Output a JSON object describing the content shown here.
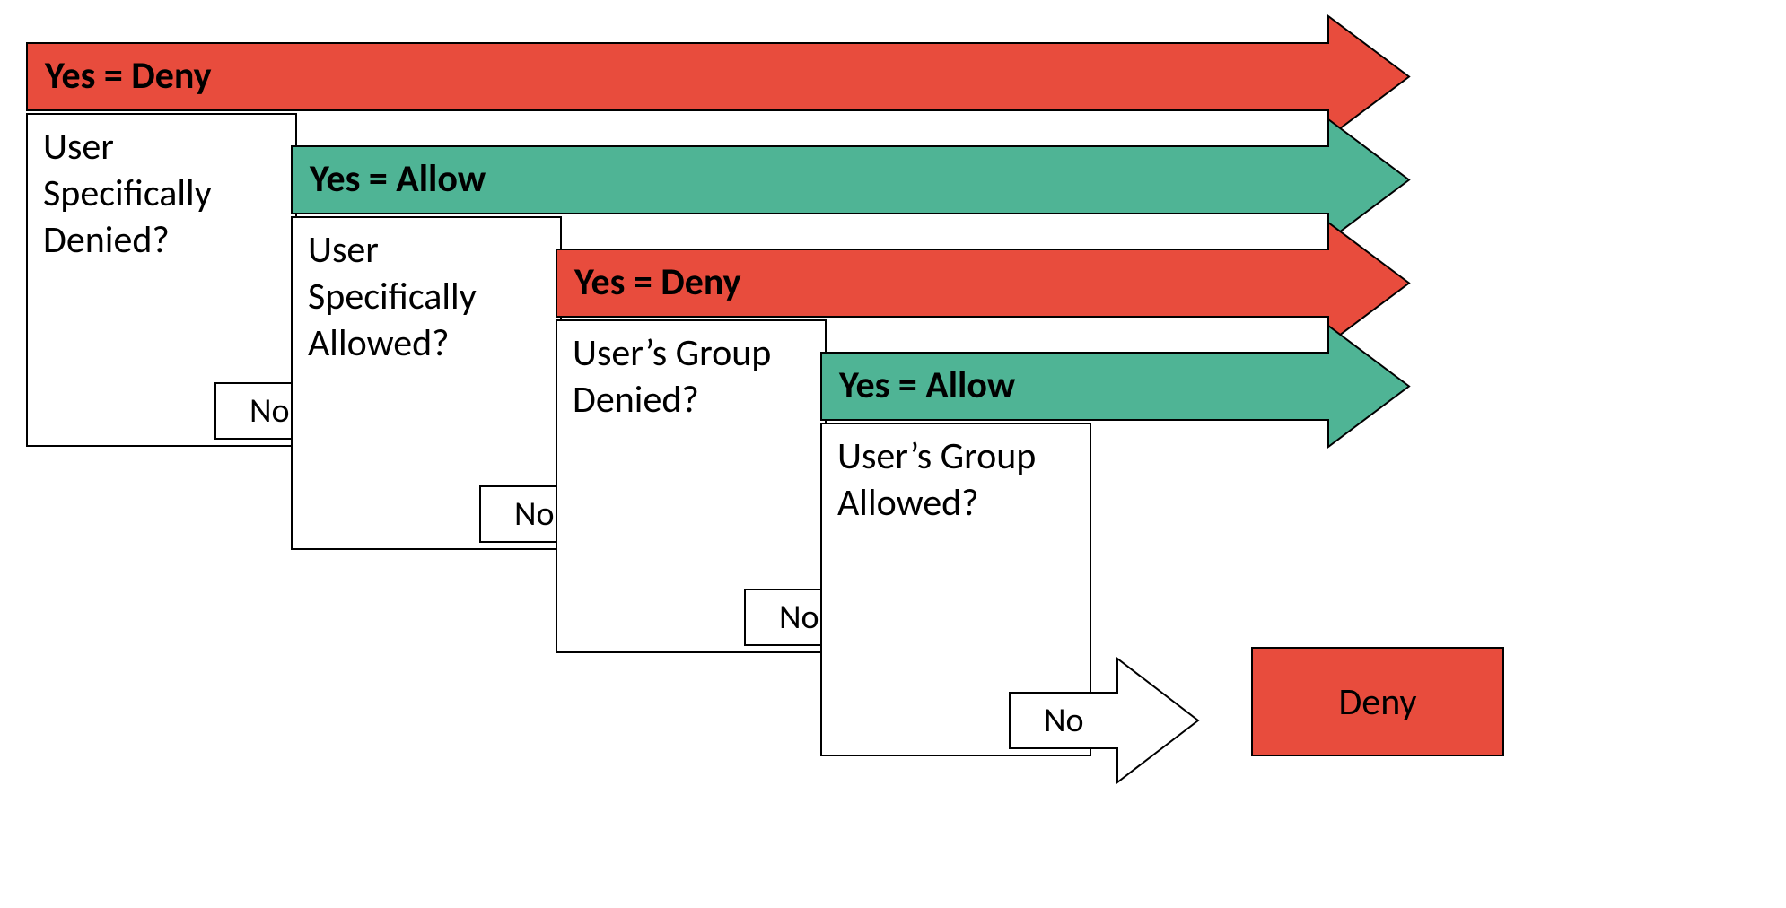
{
  "colors": {
    "deny": "#E84C3D",
    "allow": "#4FB495",
    "stroke": "#000000",
    "white": "#FFFFFF"
  },
  "steps": [
    {
      "header": "Yes = Deny",
      "question_line1": "User",
      "question_line2": "Specifically",
      "question_line3": "Denied?",
      "isAllow": false
    },
    {
      "header": "Yes = Allow",
      "question_line1": "User",
      "question_line2": "Specifically",
      "question_line3": "Allowed?",
      "isAllow": true
    },
    {
      "header": "Yes = Deny",
      "question_line1": "User’s Group",
      "question_line2": "Denied?",
      "question_line3": "",
      "isAllow": false
    },
    {
      "header": "Yes = Allow",
      "question_line1": "User’s Group",
      "question_line2": "Allowed?",
      "question_line3": "",
      "isAllow": true
    }
  ],
  "no_label": "No",
  "final": "Deny"
}
